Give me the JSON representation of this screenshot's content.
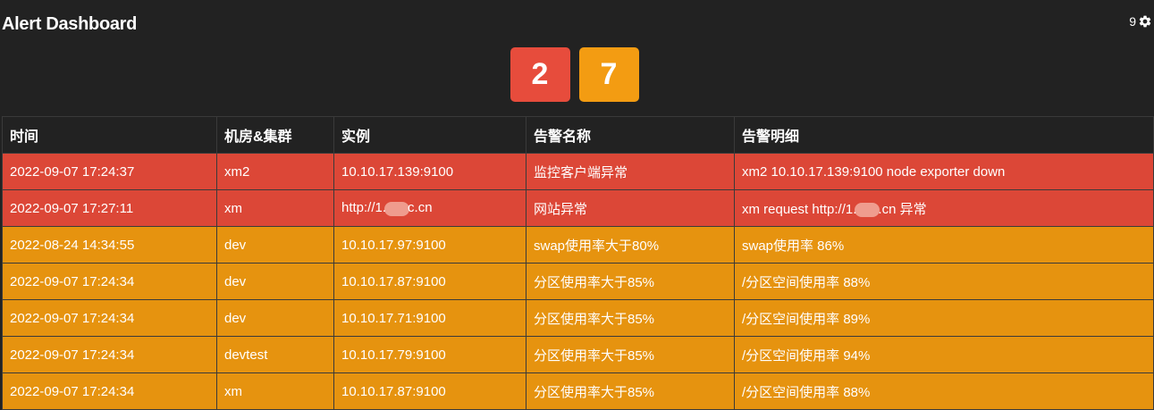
{
  "header": {
    "title": "Alert Dashboard",
    "settings_count": "9",
    "settings_icon": "gear-icon"
  },
  "counters": {
    "critical": "2",
    "warning": "7",
    "critical_color": "#e74c3c",
    "warning_color": "#f39c12"
  },
  "table": {
    "columns": [
      "时间",
      "机房&集群",
      "实例",
      "告警名称",
      "告警明细"
    ],
    "rows": [
      {
        "severity": "critical",
        "time": "2022-09-07 17:24:37",
        "cluster": "xm2",
        "instance": "10.10.17.139:9100",
        "name": "监控客户端异常",
        "detail": "xm2 10.10.17.139:9100 node exporter down"
      },
      {
        "severity": "critical",
        "time": "2022-09-07 17:27:11",
        "cluster": "xm",
        "instance_pre": "http://1.",
        "instance_post": "c.cn",
        "name": "网站异常",
        "detail_pre": "xm request http://1.",
        "detail_post": ".cn 异常"
      },
      {
        "severity": "warning",
        "time": "2022-08-24 14:34:55",
        "cluster": "dev",
        "instance": "10.10.17.97:9100",
        "name": "swap使用率大于80%",
        "detail": "swap使用率 86%"
      },
      {
        "severity": "warning",
        "time": "2022-09-07 17:24:34",
        "cluster": "dev",
        "instance": "10.10.17.87:9100",
        "name": "分区使用率大于85%",
        "detail": "/分区空间使用率 88%"
      },
      {
        "severity": "warning",
        "time": "2022-09-07 17:24:34",
        "cluster": "dev",
        "instance": "10.10.17.71:9100",
        "name": "分区使用率大于85%",
        "detail": "/分区空间使用率 89%"
      },
      {
        "severity": "warning",
        "time": "2022-09-07 17:24:34",
        "cluster": "devtest",
        "instance": "10.10.17.79:9100",
        "name": "分区使用率大于85%",
        "detail": "/分区空间使用率 94%"
      },
      {
        "severity": "warning",
        "time": "2022-09-07 17:24:34",
        "cluster": "xm",
        "instance": "10.10.17.87:9100",
        "name": "分区使用率大于85%",
        "detail": "/分区空间使用率 88%"
      }
    ],
    "critical_row_color": "#dc4737",
    "warning_row_color": "#e6930f"
  }
}
